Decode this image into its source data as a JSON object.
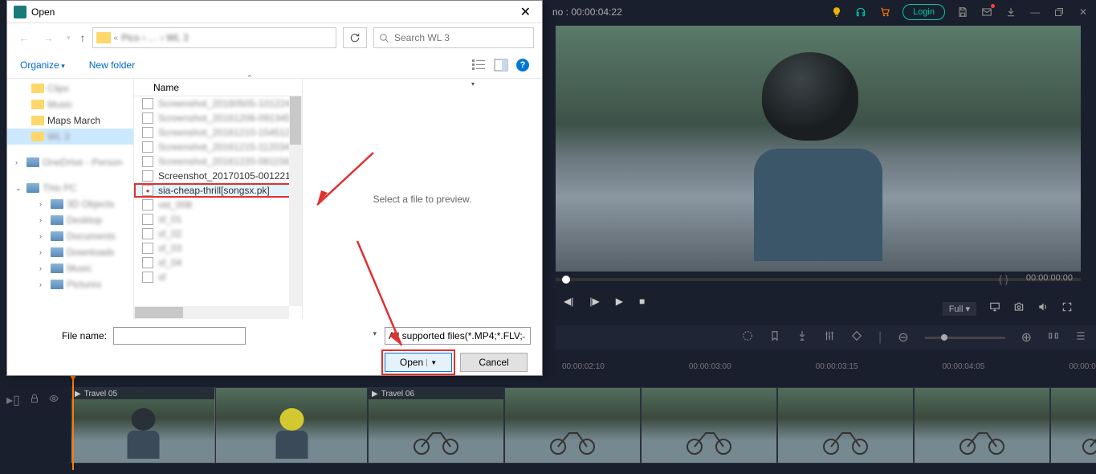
{
  "titlebar": {
    "project_time_label": "no : 00:00:04:22",
    "login": "Login"
  },
  "preview": {
    "time_current": "00:00:00:00",
    "brackets": "{    }",
    "quality_label": "Full"
  },
  "timeline": {
    "markers": [
      "00:00:02:10",
      "00:00:03:00",
      "00:00:03:15",
      "00:00:04:05",
      "00:00:0"
    ],
    "clips": [
      {
        "label": "Travel 05"
      },
      {
        "label": ""
      },
      {
        "label": "Travel 06"
      },
      {
        "label": ""
      },
      {
        "label": ""
      },
      {
        "label": ""
      },
      {
        "label": ""
      },
      {
        "label": ""
      }
    ]
  },
  "dialog": {
    "title": "Open",
    "search_placeholder": "Search WL 3",
    "organize": "Organize",
    "new_folder": "New folder",
    "name_header": "Name",
    "preview_text": "Select a file to preview.",
    "file_name_label": "File name:",
    "filetype": "All supported files(*.MP4;*.FLV;",
    "open_btn": "Open",
    "cancel_btn": "Cancel",
    "tree": [
      {
        "label": "Clips",
        "depth": 0,
        "blurred": true
      },
      {
        "label": "Music",
        "depth": 0,
        "blurred": true
      },
      {
        "label": "Maps March",
        "depth": 0,
        "blurred": false
      },
      {
        "label": "WL 3",
        "depth": 0,
        "selected": true,
        "blurred": true
      },
      {
        "label": "OneDrive - Person",
        "depth": 0,
        "chevron": ">",
        "icon": "cloud",
        "blurred": true
      },
      {
        "label": "This PC",
        "depth": 0,
        "chevron": "v",
        "icon": "pc",
        "blurred": true
      },
      {
        "label": "3D Objects",
        "depth": 1,
        "blurred": true,
        "icon": "drive"
      },
      {
        "label": "Desktop",
        "depth": 1,
        "blurred": true,
        "icon": "drive"
      },
      {
        "label": "Documents",
        "depth": 1,
        "blurred": true,
        "icon": "drive"
      },
      {
        "label": "Downloads",
        "depth": 1,
        "blurred": true,
        "icon": "drive"
      },
      {
        "label": "Music",
        "depth": 1,
        "blurred": true,
        "icon": "drive"
      },
      {
        "label": "Pictures",
        "depth": 1,
        "blurred": true,
        "icon": "drive"
      }
    ],
    "files": [
      {
        "name": "Screenshot_20160505-101224",
        "blurred": true
      },
      {
        "name": "Screenshot_20161206-091345",
        "blurred": true
      },
      {
        "name": "Screenshot_20161210-154512",
        "blurred": true
      },
      {
        "name": "Screenshot_20161215-112034",
        "blurred": true
      },
      {
        "name": "Screenshot_20161220-081156",
        "blurred": true
      },
      {
        "name": "Screenshot_20170105-001221",
        "blurred": false
      },
      {
        "name": "sia-cheap-thrill[songsx.pk]",
        "highlighted": true,
        "audio": true,
        "blurred": false
      },
      {
        "name": "vid_008",
        "blurred": true
      },
      {
        "name": "sf_01",
        "blurred": true
      },
      {
        "name": "sf_02",
        "blurred": true
      },
      {
        "name": "sf_03",
        "blurred": true
      },
      {
        "name": "sf_04",
        "blurred": true
      },
      {
        "name": "sf",
        "blurred": true
      }
    ]
  }
}
